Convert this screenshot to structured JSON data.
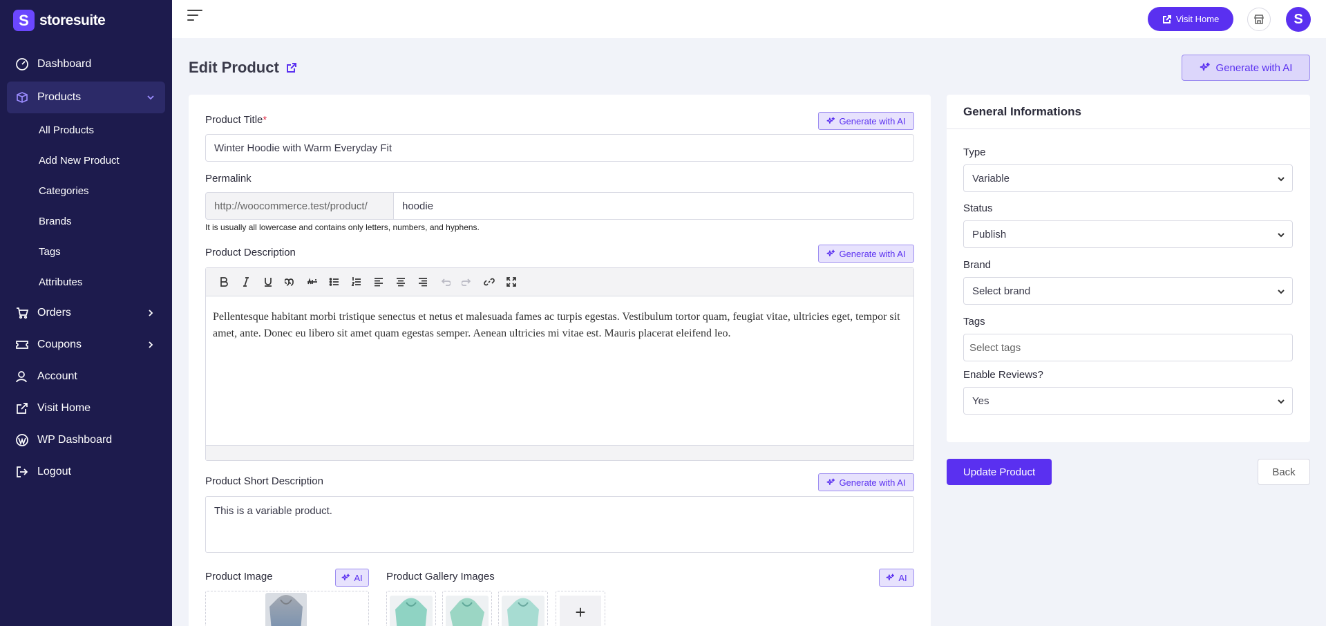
{
  "brand": {
    "logo_letter": "S",
    "name": "storesuite"
  },
  "sidebar": {
    "items": [
      {
        "label": "Dashboard",
        "icon": "gauge-icon"
      },
      {
        "label": "Products",
        "icon": "box-icon"
      },
      {
        "label": "Orders",
        "icon": "cart-icon"
      },
      {
        "label": "Coupons",
        "icon": "coupon-icon"
      },
      {
        "label": "Account",
        "icon": "user-icon"
      },
      {
        "label": "Visit Home",
        "icon": "external-link-icon"
      },
      {
        "label": "WP Dashboard",
        "icon": "wordpress-icon"
      },
      {
        "label": "Logout",
        "icon": "logout-icon"
      }
    ],
    "product_sub": [
      "All Products",
      "Add New Product",
      "Categories",
      "Brands",
      "Tags",
      "Attributes"
    ]
  },
  "topbar": {
    "visit_home": "Visit Home",
    "avatar_letter": "S"
  },
  "page": {
    "title": "Edit Product",
    "generate_ai": "Generate with AI"
  },
  "form": {
    "product_title_label": "Product Title",
    "required_mark": "*",
    "product_title_value": "Winter Hoodie with Warm Everyday Fit",
    "generate_ai_small": "Generate with AI",
    "permalink_label": "Permalink",
    "permalink_prefix": "http://woocommerce.test/product/",
    "permalink_slug": "hoodie",
    "permalink_hint": "It is usually all lowercase and contains only letters, numbers, and hyphens.",
    "description_label": "Product Description",
    "description_text": "Pellentesque habitant morbi tristique senectus et netus et malesuada fames ac turpis egestas. Vestibulum tortor quam, feugiat vitae, ultricies eget, tempor sit amet, ante. Donec eu libero sit amet quam egestas semper. Aenean ultricies mi vitae est. Mauris placerat eleifend leo.",
    "short_description_label": "Product Short Description",
    "short_description_value": "This is a variable product.",
    "product_image_label": "Product Image",
    "gallery_label": "Product Gallery Images",
    "ai_label": "AI",
    "add_symbol": "+"
  },
  "side": {
    "header": "General Informations",
    "type_label": "Type",
    "type_value": "Variable",
    "status_label": "Status",
    "status_value": "Publish",
    "brand_label": "Brand",
    "brand_value": "Select brand",
    "tags_label": "Tags",
    "tags_placeholder": "Select tags",
    "reviews_label": "Enable Reviews?",
    "reviews_value": "Yes"
  },
  "actions": {
    "update": "Update Product",
    "back": "Back"
  },
  "colors": {
    "sidebar": "#1d1b4d",
    "accent": "#5a30f0",
    "background": "#f1f3f9"
  }
}
